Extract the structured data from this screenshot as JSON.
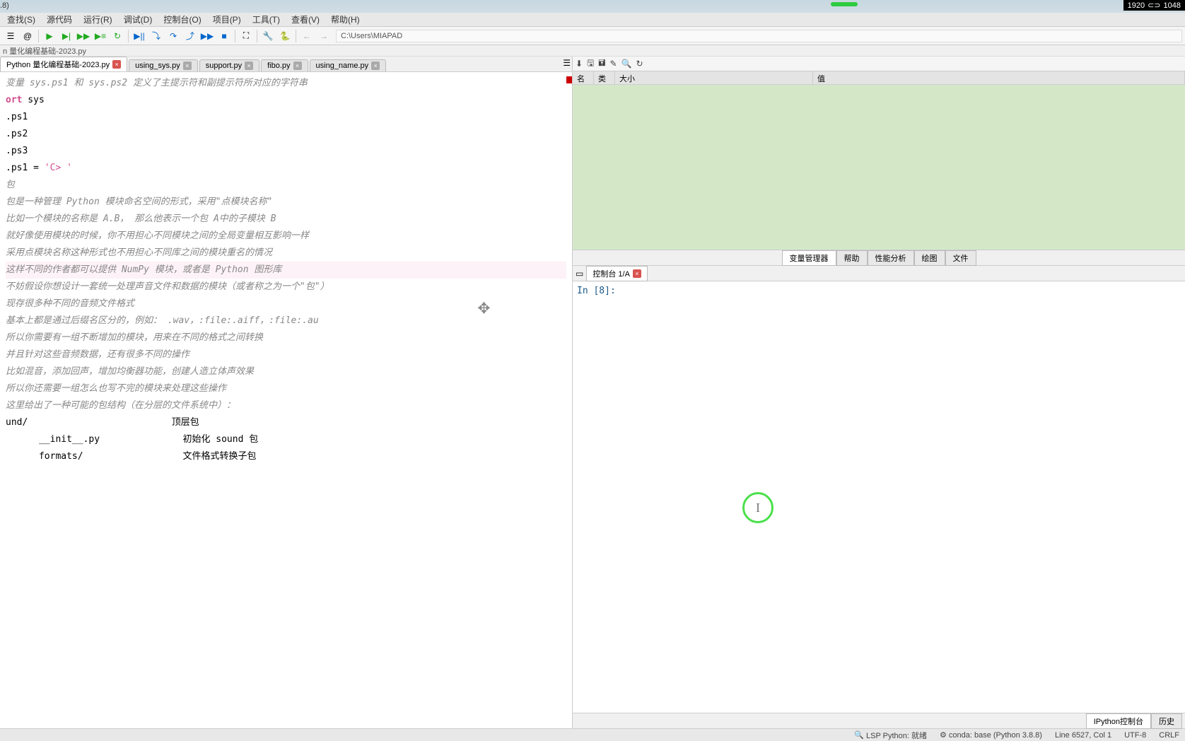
{
  "top": {
    "left_text": ".8)",
    "resolution_w": "1920",
    "resolution_h": "1048"
  },
  "menu": {
    "items": [
      "查找(S)",
      "源代码",
      "运行(R)",
      "调试(D)",
      "控制台(O)",
      "项目(P)",
      "工具(T)",
      "查看(V)",
      "帮助(H)"
    ]
  },
  "toolbar": {
    "path": "C:\\Users\\MIAPAD"
  },
  "breadcrumb": "n 量化编程基础-2023.py",
  "tabs": [
    {
      "label": "Python 量化编程基础-2023.py",
      "active": true,
      "close_red": true
    },
    {
      "label": "using_sys.py",
      "active": false,
      "close_red": false
    },
    {
      "label": "support.py",
      "active": false,
      "close_red": false
    },
    {
      "label": "fibo.py",
      "active": false,
      "close_red": false
    },
    {
      "label": "using_name.py",
      "active": false,
      "close_red": false
    }
  ],
  "code_lines": [
    {
      "t": "变量 sys.ps1 和 sys.ps2 定义了主提示符和副提示符所对应的字符串",
      "cls": "comment"
    },
    {
      "t": "",
      "cls": ""
    },
    {
      "t": "import sys",
      "cls": "",
      "kw": "ort"
    },
    {
      "t": "",
      "cls": ""
    },
    {
      "t": ".ps1",
      "cls": ""
    },
    {
      "t": "",
      "cls": ""
    },
    {
      "t": ".ps2",
      "cls": ""
    },
    {
      "t": "",
      "cls": ""
    },
    {
      "t": ".ps3",
      "cls": ""
    },
    {
      "t": "",
      "cls": ""
    },
    {
      "t": ".ps1 = 'C> '",
      "cls": "",
      "str": true
    },
    {
      "t": "",
      "cls": ""
    },
    {
      "t": "",
      "cls": ""
    },
    {
      "t": "",
      "cls": ""
    },
    {
      "t": "包",
      "cls": "comment"
    },
    {
      "t": "",
      "cls": ""
    },
    {
      "t": "包是一种管理 Python 模块命名空间的形式，采用\"点模块名称\"",
      "cls": "comment"
    },
    {
      "t": "",
      "cls": ""
    },
    {
      "t": "比如一个模块的名称是 A.B， 那么他表示一个包 A中的子模块 B",
      "cls": "comment"
    },
    {
      "t": "",
      "cls": ""
    },
    {
      "t": "就好像使用模块的时候，你不用担心不同模块之间的全局变量相互影响一样",
      "cls": "comment"
    },
    {
      "t": "",
      "cls": ""
    },
    {
      "t": "采用点模块名称这种形式也不用担心不同库之间的模块重名的情况",
      "cls": "comment"
    },
    {
      "t": "",
      "cls": ""
    },
    {
      "t": "这样不同的作者都可以提供 NumPy 模块，或者是 Python 图形库",
      "cls": "comment",
      "hl": true
    },
    {
      "t": "",
      "cls": ""
    },
    {
      "t": "不妨假设你想设计一套统一处理声音文件和数据的模块（或者称之为一个\"包\"）",
      "cls": "comment"
    },
    {
      "t": "",
      "cls": ""
    },
    {
      "t": "现存很多种不同的音频文件格式",
      "cls": "comment"
    },
    {
      "t": "基本上都是通过后缀名区分的，例如： .wav，:file:.aiff，:file:.au",
      "cls": "comment"
    },
    {
      "t": "",
      "cls": ""
    },
    {
      "t": "所以你需要有一组不断增加的模块，用来在不同的格式之间转换",
      "cls": "comment"
    },
    {
      "t": "",
      "cls": ""
    },
    {
      "t": "并且针对这些音频数据，还有很多不同的操作",
      "cls": "comment"
    },
    {
      "t": "比如混音，添加回声，增加均衡器功能，创建人造立体声效果",
      "cls": "comment"
    },
    {
      "t": "",
      "cls": ""
    },
    {
      "t": "所以你还需要一组怎么也写不完的模块来处理这些操作",
      "cls": "comment"
    },
    {
      "t": "",
      "cls": ""
    },
    {
      "t": "这里给出了一种可能的包结构（在分层的文件系统中）：",
      "cls": "comment"
    },
    {
      "t": "",
      "cls": ""
    },
    {
      "t": "und/                          顶层包",
      "cls": ""
    },
    {
      "t": "      __init__.py               初始化 sound 包",
      "cls": ""
    },
    {
      "t": "      formats/                  文件格式转换子包",
      "cls": ""
    }
  ],
  "var_panel": {
    "columns": {
      "name": "名称",
      "type": "类型",
      "size": "大小",
      "value": "值"
    },
    "tabs": [
      "变量管理器",
      "帮助",
      "性能分析",
      "绘图",
      "文件"
    ],
    "active_tab": 0
  },
  "console": {
    "tab_label": "控制台 1/A",
    "prompt": "In [8]:",
    "bottom_tabs": [
      "IPython控制台",
      "历史"
    ],
    "active_bottom": 0
  },
  "status": {
    "lsp": "LSP Python: 就绪",
    "conda": "conda: base (Python 3.8.8)",
    "linecol": "Line 6527, Col 1",
    "encoding": "UTF-8",
    "eol": "CRLF"
  }
}
